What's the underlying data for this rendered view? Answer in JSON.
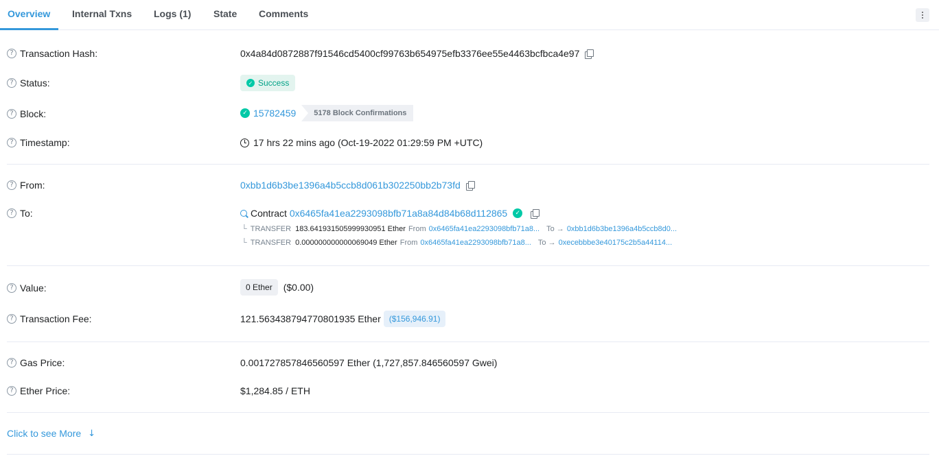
{
  "tabs": [
    {
      "label": "Overview"
    },
    {
      "label": "Internal Txns"
    },
    {
      "label": "Logs (1)"
    },
    {
      "label": "State"
    },
    {
      "label": "Comments"
    }
  ],
  "labels": {
    "tx_hash": "Transaction Hash:",
    "status": "Status:",
    "block": "Block:",
    "timestamp": "Timestamp:",
    "from": "From:",
    "to": "To:",
    "value": "Value:",
    "fee": "Transaction Fee:",
    "gas_price": "Gas Price:",
    "ether_price": "Ether Price:"
  },
  "tx_hash": "0x4a84d0872887f91546cd5400cf99763b654975efb3376ee55e4463bcfbca4e97",
  "status": "Success",
  "block": {
    "number": "15782459",
    "confirmations": "5178 Block Confirmations"
  },
  "timestamp": "17 hrs 22 mins ago (Oct-19-2022 01:29:59 PM +UTC)",
  "from": "0xbb1d6b3be1396a4b5ccb8d061b302250bb2b73fd",
  "to": {
    "prefix": "Contract",
    "address": "0x6465fa41ea2293098bfb71a8a84d84b68d112865"
  },
  "transfers": [
    {
      "label": "TRANSFER",
      "amount": "183.641931505999930951 Ether",
      "from_label": "From",
      "from": "0x6465fa41ea2293098bfb71a8...",
      "to_label": "To →",
      "to": "0xbb1d6b3be1396a4b5ccb8d0..."
    },
    {
      "label": "TRANSFER",
      "amount": "0.000000000000069049 Ether",
      "from_label": "From",
      "from": "0x6465fa41ea2293098bfb71a8...",
      "to_label": "To →",
      "to": "0xecebbbe3e40175c2b5a44114..."
    }
  ],
  "value": {
    "amount": "0 Ether",
    "usd": "($0.00)"
  },
  "fee": {
    "amount": "121.563438794770801935 Ether",
    "usd": "($156,946.91)"
  },
  "gas_price": "0.001727857846560597 Ether (1,727,857.846560597 Gwei)",
  "ether_price": "$1,284.85 / ETH",
  "see_more": "Click to see More",
  "colors": {
    "accent": "#3498db",
    "success": "#00c9a7"
  }
}
